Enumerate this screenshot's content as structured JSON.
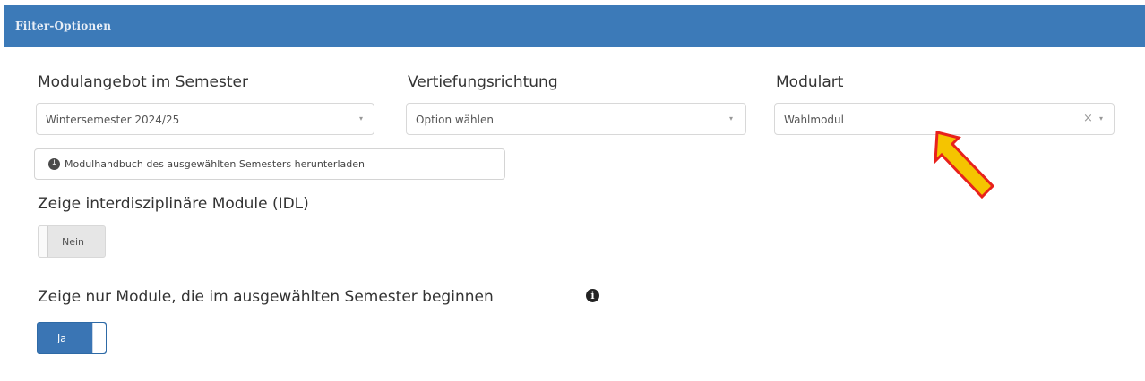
{
  "panel": {
    "title": "Filter-Optionen"
  },
  "filters": {
    "semester": {
      "label": "Modulangebot im Semester",
      "value": "Wintersemester 2024/25",
      "caret": "▾"
    },
    "vertiefung": {
      "label": "Vertiefungsrichtung",
      "value": "Option wählen",
      "caret": "▾"
    },
    "modulart": {
      "label": "Modulart",
      "value": "Wahlmodul",
      "clear": "×",
      "caret": "▾"
    }
  },
  "download": {
    "icon": "download-circle-icon",
    "label": "Modulhandbuch des ausgewählten Semesters herunterladen"
  },
  "idl": {
    "label": "Zeige interdisziplinäre Module (IDL)",
    "state": "Nein"
  },
  "semester_start": {
    "label": "Zeige nur Module, die im ausgewählten Semester beginnen",
    "info_icon": "i",
    "state": "Ja"
  },
  "colors": {
    "header": "#3c7ab8",
    "toggle_on": "#3a75b4",
    "arrow_fill": "#f5c400",
    "arrow_stroke": "#e8211c"
  }
}
